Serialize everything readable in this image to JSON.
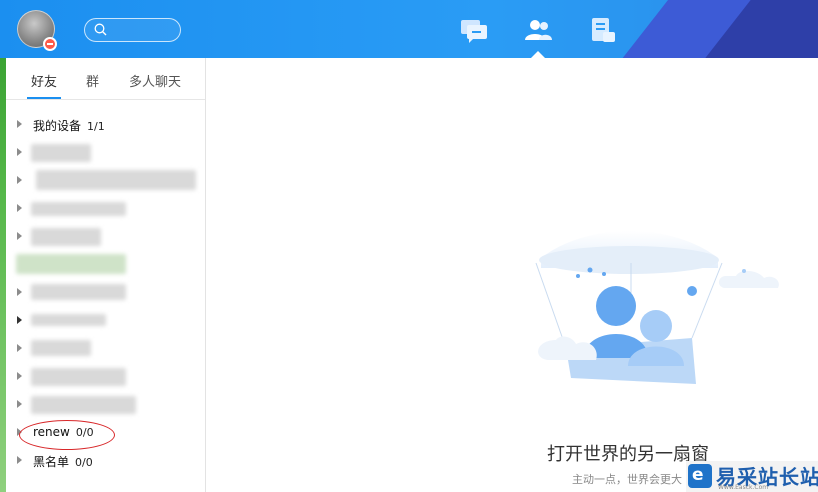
{
  "header": {
    "search_placeholder": "",
    "nav": [
      {
        "name": "messages",
        "icon": "chat-icon",
        "active": false
      },
      {
        "name": "contacts",
        "icon": "contacts-icon",
        "active": true
      },
      {
        "name": "documents",
        "icon": "document-icon",
        "active": false
      }
    ],
    "accent": "#1b8ff0"
  },
  "sidebar": {
    "tabs": [
      {
        "label": "好友",
        "active": true
      },
      {
        "label": "群",
        "active": false
      },
      {
        "label": "多人聊天",
        "active": false
      }
    ],
    "groups": {
      "my_devices": {
        "label": "我的设备",
        "count": "1/1"
      },
      "renew": {
        "label": "renew",
        "count": "0/0"
      },
      "blacklist": {
        "label": "黑名单",
        "count": "0/0"
      }
    }
  },
  "main": {
    "title": "打开世界的另一扇窗",
    "subtitle": "主动一点，世界会更大"
  },
  "watermark": {
    "logo": "e",
    "text": "易采站长站",
    "sub": "Www.Easck.Com"
  }
}
